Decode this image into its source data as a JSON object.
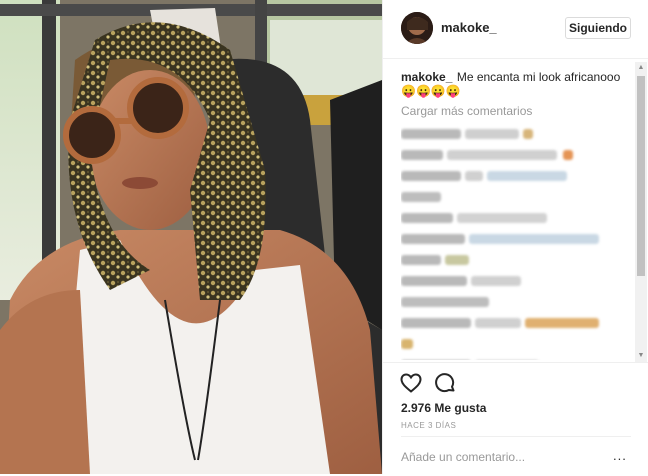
{
  "post": {
    "username": "makoke_",
    "follow_button": "Siguiendo",
    "caption_user": "makoke_",
    "caption_text": "Me encanta mi look africanooo",
    "caption_emoji": "😛😛😛😛",
    "load_more": "Cargar más comentarios",
    "likes": "2.976 Me gusta",
    "timestamp": "HACE 3 DÍAS",
    "comment_placeholder": "Añade un comentario...",
    "more_options": "..."
  },
  "icons": {
    "like": "heart-icon",
    "comment": "comment-icon",
    "more": "more-options-icon"
  },
  "colors": {
    "text": "#262626",
    "muted": "#999999",
    "border": "#efefef"
  }
}
